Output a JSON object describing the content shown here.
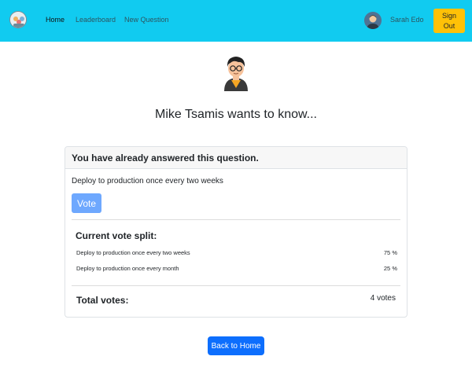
{
  "nav": {
    "links": [
      {
        "label": "Home",
        "active": true
      },
      {
        "label": "Leaderboard",
        "active": false
      },
      {
        "label": "New Question",
        "active": false
      }
    ],
    "user_name": "Sarah Edo",
    "signout_label": "Sign Out"
  },
  "question": {
    "heading": "Mike Tsamis wants to know...",
    "answered_notice": "You have already answered this question.",
    "selected_option": "Deploy to production once every two weeks",
    "vote_label": "Vote"
  },
  "results": {
    "title": "Current vote split:",
    "rows": [
      {
        "option": "Deploy to production once every two weeks",
        "percent": "75 %"
      },
      {
        "option": "Deploy to production once every month",
        "percent": "25 %"
      }
    ],
    "total_label": "Total votes:",
    "total_value": "4 votes"
  },
  "footer": {
    "back_label": "Back to Home"
  },
  "colors": {
    "navbar": "#11cbf0",
    "signout": "#ffc107",
    "primary": "#0d6efd",
    "vote_disabled": "#6ea8fe"
  }
}
